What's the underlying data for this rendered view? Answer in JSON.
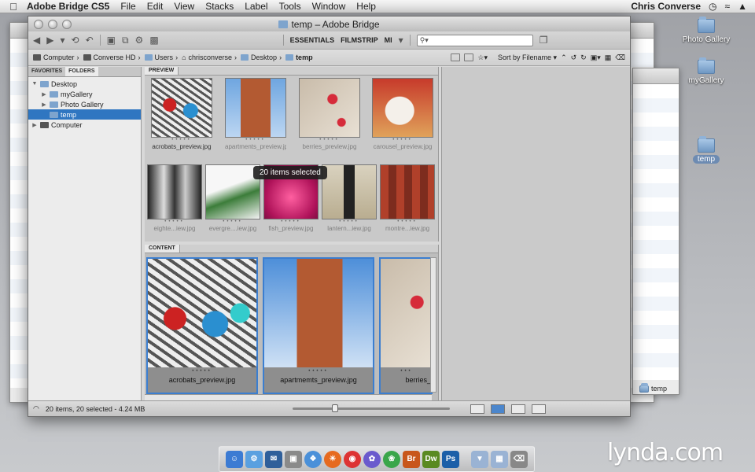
{
  "menubar": {
    "app": "Adobe Bridge CS5",
    "items": [
      "File",
      "Edit",
      "View",
      "Stacks",
      "Label",
      "Tools",
      "Window",
      "Help"
    ],
    "user": "Chris Converse"
  },
  "desktop": {
    "icons": [
      {
        "label": "Photo Gallery"
      },
      {
        "label": "myGallery"
      },
      {
        "label": "temp"
      }
    ],
    "bg_window_path": "temp"
  },
  "window": {
    "title": "temp – Adobe Bridge"
  },
  "toolbar": {
    "workspaces": [
      "ESSENTIALS",
      "FILMSTRIP",
      "MI"
    ],
    "search_placeholder": ""
  },
  "path": {
    "crumbs": [
      "Computer",
      "Converse HD",
      "Users",
      "chrisconverse",
      "Desktop",
      "temp"
    ],
    "sort_label": "Sort by Filename"
  },
  "panels": {
    "favorites_tab": "FAVORITES",
    "folders_tab": "FOLDERS",
    "preview_tab": "PREVIEW",
    "content_tab": "CONTENT"
  },
  "tree": [
    {
      "label": "Desktop",
      "level": 0,
      "expanded": true
    },
    {
      "label": "myGallery",
      "level": 1
    },
    {
      "label": "Photo Gallery",
      "level": 1
    },
    {
      "label": "temp",
      "level": 1,
      "selected": true
    },
    {
      "label": "Computer",
      "level": 0,
      "computer": true
    }
  ],
  "preview": {
    "tooltip": "20 items selected",
    "row1": [
      "acrobats_preview.jpg",
      "apartments_preview.jpg",
      "berries_preview.jpg",
      "carousel_preview.jpg"
    ],
    "row2": [
      "eighte...iew.jpg",
      "evergre....iew.jpg",
      "fish_preview.jpg",
      "lantern...iew.jpg",
      "montre...iew.jpg"
    ]
  },
  "content": {
    "items": [
      "acrobats_preview.jpg",
      "apartmemts_preview.jpg",
      "berries_"
    ]
  },
  "status": {
    "text": "20 items, 20 selected - 4.24 MB"
  },
  "dock": {
    "labels": [
      "Br",
      "Dw",
      "Ps"
    ]
  },
  "watermark": "lynda.com"
}
